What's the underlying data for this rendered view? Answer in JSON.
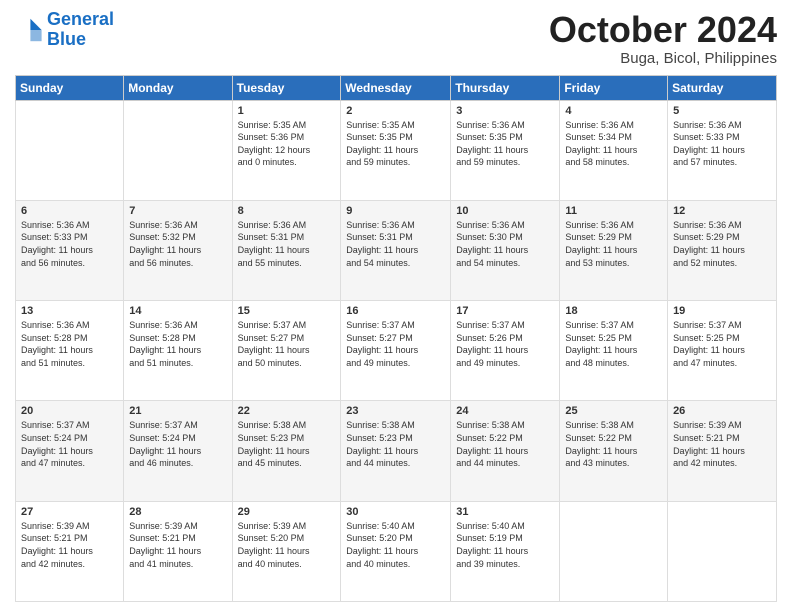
{
  "logo": {
    "line1": "General",
    "line2": "Blue"
  },
  "title": "October 2024",
  "location": "Buga, Bicol, Philippines",
  "days_header": [
    "Sunday",
    "Monday",
    "Tuesday",
    "Wednesday",
    "Thursday",
    "Friday",
    "Saturday"
  ],
  "weeks": [
    [
      {
        "day": "",
        "detail": ""
      },
      {
        "day": "",
        "detail": ""
      },
      {
        "day": "1",
        "detail": "Sunrise: 5:35 AM\nSunset: 5:36 PM\nDaylight: 12 hours\nand 0 minutes."
      },
      {
        "day": "2",
        "detail": "Sunrise: 5:35 AM\nSunset: 5:35 PM\nDaylight: 11 hours\nand 59 minutes."
      },
      {
        "day": "3",
        "detail": "Sunrise: 5:36 AM\nSunset: 5:35 PM\nDaylight: 11 hours\nand 59 minutes."
      },
      {
        "day": "4",
        "detail": "Sunrise: 5:36 AM\nSunset: 5:34 PM\nDaylight: 11 hours\nand 58 minutes."
      },
      {
        "day": "5",
        "detail": "Sunrise: 5:36 AM\nSunset: 5:33 PM\nDaylight: 11 hours\nand 57 minutes."
      }
    ],
    [
      {
        "day": "6",
        "detail": "Sunrise: 5:36 AM\nSunset: 5:33 PM\nDaylight: 11 hours\nand 56 minutes."
      },
      {
        "day": "7",
        "detail": "Sunrise: 5:36 AM\nSunset: 5:32 PM\nDaylight: 11 hours\nand 56 minutes."
      },
      {
        "day": "8",
        "detail": "Sunrise: 5:36 AM\nSunset: 5:31 PM\nDaylight: 11 hours\nand 55 minutes."
      },
      {
        "day": "9",
        "detail": "Sunrise: 5:36 AM\nSunset: 5:31 PM\nDaylight: 11 hours\nand 54 minutes."
      },
      {
        "day": "10",
        "detail": "Sunrise: 5:36 AM\nSunset: 5:30 PM\nDaylight: 11 hours\nand 54 minutes."
      },
      {
        "day": "11",
        "detail": "Sunrise: 5:36 AM\nSunset: 5:29 PM\nDaylight: 11 hours\nand 53 minutes."
      },
      {
        "day": "12",
        "detail": "Sunrise: 5:36 AM\nSunset: 5:29 PM\nDaylight: 11 hours\nand 52 minutes."
      }
    ],
    [
      {
        "day": "13",
        "detail": "Sunrise: 5:36 AM\nSunset: 5:28 PM\nDaylight: 11 hours\nand 51 minutes."
      },
      {
        "day": "14",
        "detail": "Sunrise: 5:36 AM\nSunset: 5:28 PM\nDaylight: 11 hours\nand 51 minutes."
      },
      {
        "day": "15",
        "detail": "Sunrise: 5:37 AM\nSunset: 5:27 PM\nDaylight: 11 hours\nand 50 minutes."
      },
      {
        "day": "16",
        "detail": "Sunrise: 5:37 AM\nSunset: 5:27 PM\nDaylight: 11 hours\nand 49 minutes."
      },
      {
        "day": "17",
        "detail": "Sunrise: 5:37 AM\nSunset: 5:26 PM\nDaylight: 11 hours\nand 49 minutes."
      },
      {
        "day": "18",
        "detail": "Sunrise: 5:37 AM\nSunset: 5:25 PM\nDaylight: 11 hours\nand 48 minutes."
      },
      {
        "day": "19",
        "detail": "Sunrise: 5:37 AM\nSunset: 5:25 PM\nDaylight: 11 hours\nand 47 minutes."
      }
    ],
    [
      {
        "day": "20",
        "detail": "Sunrise: 5:37 AM\nSunset: 5:24 PM\nDaylight: 11 hours\nand 47 minutes."
      },
      {
        "day": "21",
        "detail": "Sunrise: 5:37 AM\nSunset: 5:24 PM\nDaylight: 11 hours\nand 46 minutes."
      },
      {
        "day": "22",
        "detail": "Sunrise: 5:38 AM\nSunset: 5:23 PM\nDaylight: 11 hours\nand 45 minutes."
      },
      {
        "day": "23",
        "detail": "Sunrise: 5:38 AM\nSunset: 5:23 PM\nDaylight: 11 hours\nand 44 minutes."
      },
      {
        "day": "24",
        "detail": "Sunrise: 5:38 AM\nSunset: 5:22 PM\nDaylight: 11 hours\nand 44 minutes."
      },
      {
        "day": "25",
        "detail": "Sunrise: 5:38 AM\nSunset: 5:22 PM\nDaylight: 11 hours\nand 43 minutes."
      },
      {
        "day": "26",
        "detail": "Sunrise: 5:39 AM\nSunset: 5:21 PM\nDaylight: 11 hours\nand 42 minutes."
      }
    ],
    [
      {
        "day": "27",
        "detail": "Sunrise: 5:39 AM\nSunset: 5:21 PM\nDaylight: 11 hours\nand 42 minutes."
      },
      {
        "day": "28",
        "detail": "Sunrise: 5:39 AM\nSunset: 5:21 PM\nDaylight: 11 hours\nand 41 minutes."
      },
      {
        "day": "29",
        "detail": "Sunrise: 5:39 AM\nSunset: 5:20 PM\nDaylight: 11 hours\nand 40 minutes."
      },
      {
        "day": "30",
        "detail": "Sunrise: 5:40 AM\nSunset: 5:20 PM\nDaylight: 11 hours\nand 40 minutes."
      },
      {
        "day": "31",
        "detail": "Sunrise: 5:40 AM\nSunset: 5:19 PM\nDaylight: 11 hours\nand 39 minutes."
      },
      {
        "day": "",
        "detail": ""
      },
      {
        "day": "",
        "detail": ""
      }
    ]
  ]
}
